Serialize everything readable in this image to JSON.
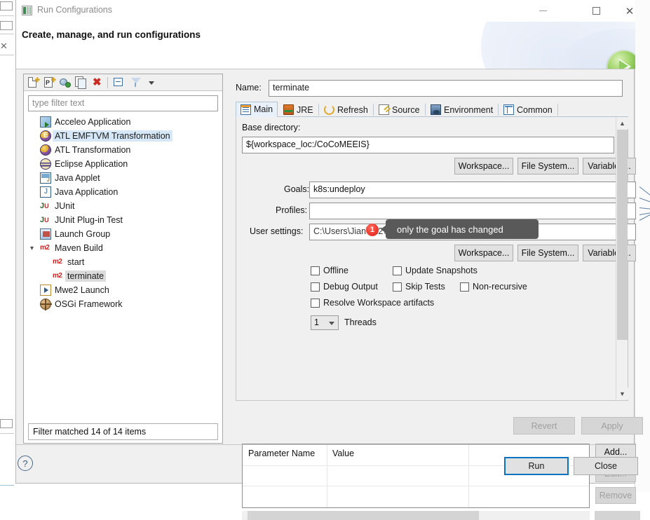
{
  "window": {
    "title": "Run Configurations",
    "header_title": "Create, manage, and run configurations",
    "minimize_label": "—",
    "maximize_label": "□",
    "close_label": "✕"
  },
  "tree_toolbar": {
    "new_config_label": "New launch configuration",
    "new_prototype_label": "New prototype",
    "export_label": "Export launch configuration",
    "duplicate_label": "Duplicate",
    "delete_label": "Delete",
    "collapse_all_label": "Collapse All",
    "filter_label": "Filter launch configurations",
    "menu_label": "View Menu"
  },
  "filter": {
    "placeholder": "type filter text",
    "value": "",
    "status": "Filter matched 14 of 14 items"
  },
  "tree": {
    "items": [
      {
        "label": "Acceleo Application",
        "icon": "acceleo-icon",
        "indent": 1,
        "state": "normal"
      },
      {
        "label": "ATL EMFTVM Transformation",
        "icon": "atl-emftvm-icon",
        "indent": 1,
        "state": "selected"
      },
      {
        "label": "ATL Transformation",
        "icon": "atl-icon",
        "indent": 1,
        "state": "normal"
      },
      {
        "label": "Eclipse Application",
        "icon": "eclipse-icon",
        "indent": 1,
        "state": "normal"
      },
      {
        "label": "Java Applet",
        "icon": "java-applet-icon",
        "indent": 1,
        "state": "normal"
      },
      {
        "label": "Java Application",
        "icon": "java-application-icon",
        "indent": 1,
        "state": "normal"
      },
      {
        "label": "JUnit",
        "icon": "junit-icon",
        "indent": 1,
        "state": "normal"
      },
      {
        "label": "JUnit Plug-in Test",
        "icon": "junit-plugin-icon",
        "indent": 1,
        "state": "normal"
      },
      {
        "label": "Launch Group",
        "icon": "launch-group-icon",
        "indent": 1,
        "state": "normal"
      },
      {
        "label": "Maven Build",
        "icon": "maven-icon",
        "indent": 0,
        "state": "expanded"
      },
      {
        "label": "start",
        "icon": "maven-icon",
        "indent": 2,
        "state": "normal"
      },
      {
        "label": "terminate",
        "icon": "maven-icon",
        "indent": 2,
        "state": "selected-gray"
      },
      {
        "label": "Mwe2 Launch",
        "icon": "mwe2-icon",
        "indent": 1,
        "state": "normal"
      },
      {
        "label": "OSGi Framework",
        "icon": "osgi-icon",
        "indent": 1,
        "state": "normal"
      }
    ]
  },
  "config": {
    "name_label": "Name:",
    "name_value": "terminate"
  },
  "tabs": [
    {
      "label": "Main",
      "icon": "main-tab-icon",
      "active": true
    },
    {
      "label": "JRE",
      "icon": "jre-tab-icon",
      "active": false
    },
    {
      "label": "Refresh",
      "icon": "refresh-tab-icon",
      "active": false
    },
    {
      "label": "Source",
      "icon": "source-tab-icon",
      "active": false
    },
    {
      "label": "Environment",
      "icon": "environment-tab-icon",
      "active": false
    },
    {
      "label": "Common",
      "icon": "common-tab-icon",
      "active": false
    }
  ],
  "main_tab": {
    "base_directory_label": "Base directory:",
    "base_directory_value": "${workspace_loc:/CoCoMEEIS}",
    "browse_row1": {
      "workspace": "Workspace...",
      "file_system": "File System...",
      "variables": "Variables..."
    },
    "goals_label": "Goals:",
    "goals_value": "k8s:undeploy",
    "profiles_label": "Profiles:",
    "profiles_value": "",
    "user_settings_label": "User settings:",
    "user_settings_value": "C:\\Users\\Jian\\.m2\\settings.xml",
    "browse_row2": {
      "workspace": "Workspace...",
      "file_system": "File System...",
      "variables": "Variables..."
    },
    "checkboxes": [
      {
        "label": "Offline",
        "checked": false
      },
      {
        "label": "Update Snapshots",
        "checked": false
      },
      {
        "label": "Debug Output",
        "checked": false
      },
      {
        "label": "Skip Tests",
        "checked": false
      },
      {
        "label": "Non-recursive",
        "checked": false
      },
      {
        "label": "Resolve Workspace artifacts",
        "checked": false
      }
    ],
    "threads_value": "1",
    "threads_label": "Threads",
    "table": {
      "columns": [
        "Parameter Name",
        "Value"
      ],
      "rows": []
    },
    "table_buttons": [
      {
        "label": "Add...",
        "enabled": true
      },
      {
        "label": "Edit...",
        "enabled": false
      },
      {
        "label": "Remove",
        "enabled": false
      }
    ]
  },
  "tooltip": {
    "text": "only the goal has changed",
    "badge": "1",
    "badge_color": "#ef3b30",
    "background": "#595959"
  },
  "footer": {
    "revert_label": "Revert",
    "apply_label": "Apply",
    "run_label": "Run",
    "close_label": "Close",
    "help_label": "?"
  }
}
